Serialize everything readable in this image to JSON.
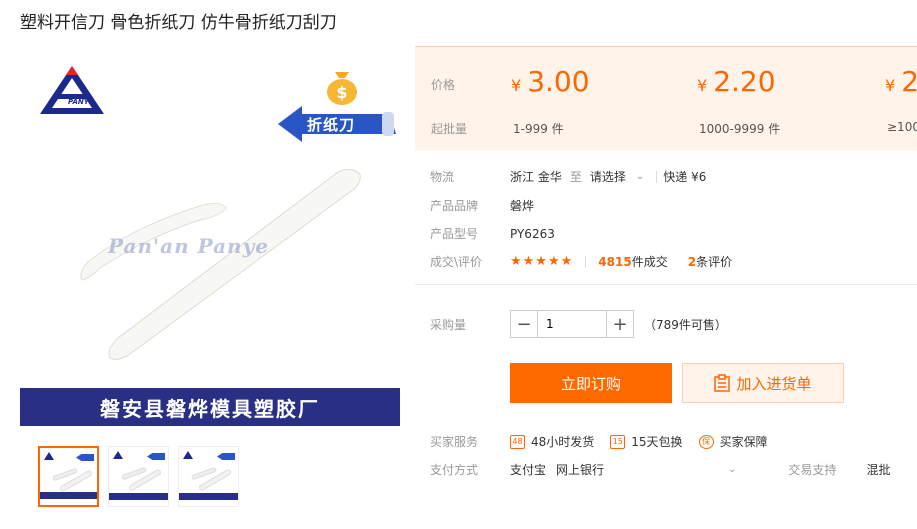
{
  "product": {
    "title": "塑料开信刀 骨色折纸刀 仿牛骨折纸刀刮刀"
  },
  "gallery": {
    "logo_text": "PANYE",
    "banner_label": "折纸刀",
    "watermark": "Pan'an Panye",
    "company_name": "磐安县磐烨模具塑胶厂",
    "dollar_symbol": "$"
  },
  "pricing": {
    "price_label": "价格",
    "moq_label": "起批量",
    "currency": "¥",
    "tiers": [
      {
        "price": "3.00",
        "range": "1-999 件"
      },
      {
        "price": "2.20",
        "range": "1000-9999 件"
      },
      {
        "price": "2",
        "range": "≥100"
      }
    ]
  },
  "details": {
    "logistics_label": "物流",
    "origin": "浙江 金华",
    "to": "至",
    "destination": "请选择",
    "shipping": "快递 ¥6",
    "brand_label": "产品品牌",
    "brand": "磐烨",
    "model_label": "产品型号",
    "model": "PY6263",
    "deals_label": "成交\\评价",
    "stars": "★★★★★",
    "deal_count": "4815",
    "deal_suffix": "件成交",
    "review_count": "2",
    "review_suffix": "条评价"
  },
  "purchase": {
    "qty_label": "采购量",
    "minus": "−",
    "plus": "+",
    "qty_value": "1",
    "stock": "（789件可售）",
    "buy_now": "立即订购",
    "add_cart": "加入进货单"
  },
  "services": {
    "label": "买家服务",
    "items": [
      {
        "icon": "48",
        "text": "48小时发货"
      },
      {
        "icon": "15",
        "text": "15天包换"
      },
      {
        "icon": "保",
        "text": "买家保障"
      }
    ]
  },
  "payment": {
    "label": "支付方式",
    "methods": "支付宝",
    "bank": "网上银行",
    "trade_label": "交易支持",
    "trade_value": "混批"
  },
  "colors": {
    "accent": "#ff6a00",
    "price_bg": "#fff3ea",
    "company_bar": "#2a2f86"
  }
}
